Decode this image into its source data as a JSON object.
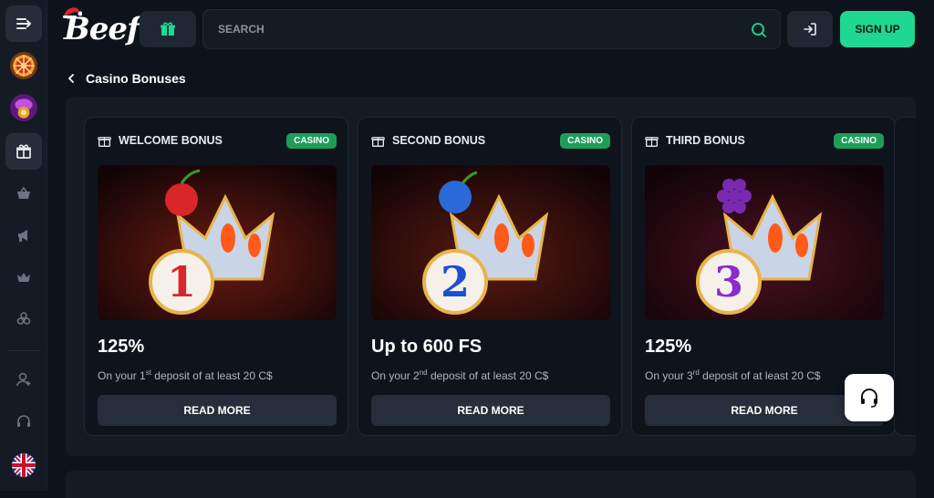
{
  "header": {
    "logo_text": "Beef",
    "search_placeholder": "SEARCH",
    "signup_label": "SIGN UP"
  },
  "breadcrumb": {
    "title": "Casino Bonuses"
  },
  "cards": [
    {
      "title": "WELCOME BONUS",
      "badge": "CASINO",
      "amount": "125%",
      "desc_pre": "On your 1",
      "desc_sup": "st",
      "desc_post": " deposit of at least 20 C$",
      "button": "READ MORE",
      "number": "1"
    },
    {
      "title": "SECOND BONUS",
      "badge": "CASINO",
      "amount": "Up to 600 FS",
      "desc_pre": "On your 2",
      "desc_sup": "nd",
      "desc_post": " deposit of at least 20 C$",
      "button": "READ MORE",
      "number": "2"
    },
    {
      "title": "THIRD BONUS",
      "badge": "CASINO",
      "amount": "125%",
      "desc_pre": "On your 3",
      "desc_sup": "rd",
      "desc_post": " deposit of at least 20 C$",
      "button": "READ MORE",
      "number": "3"
    }
  ],
  "sidebar": {
    "items": [
      "menu-toggle-icon",
      "wheel-icon",
      "mystery-icon",
      "gift-icon",
      "basket-icon",
      "megaphone-icon",
      "crown-icon",
      "clover-icon",
      "add-user-icon",
      "headset-icon",
      "uk-flag-icon"
    ]
  },
  "colors": {
    "accent": "#1fd890",
    "badge": "#1d9e58",
    "background": "#0e131b",
    "panel": "#151b25"
  }
}
